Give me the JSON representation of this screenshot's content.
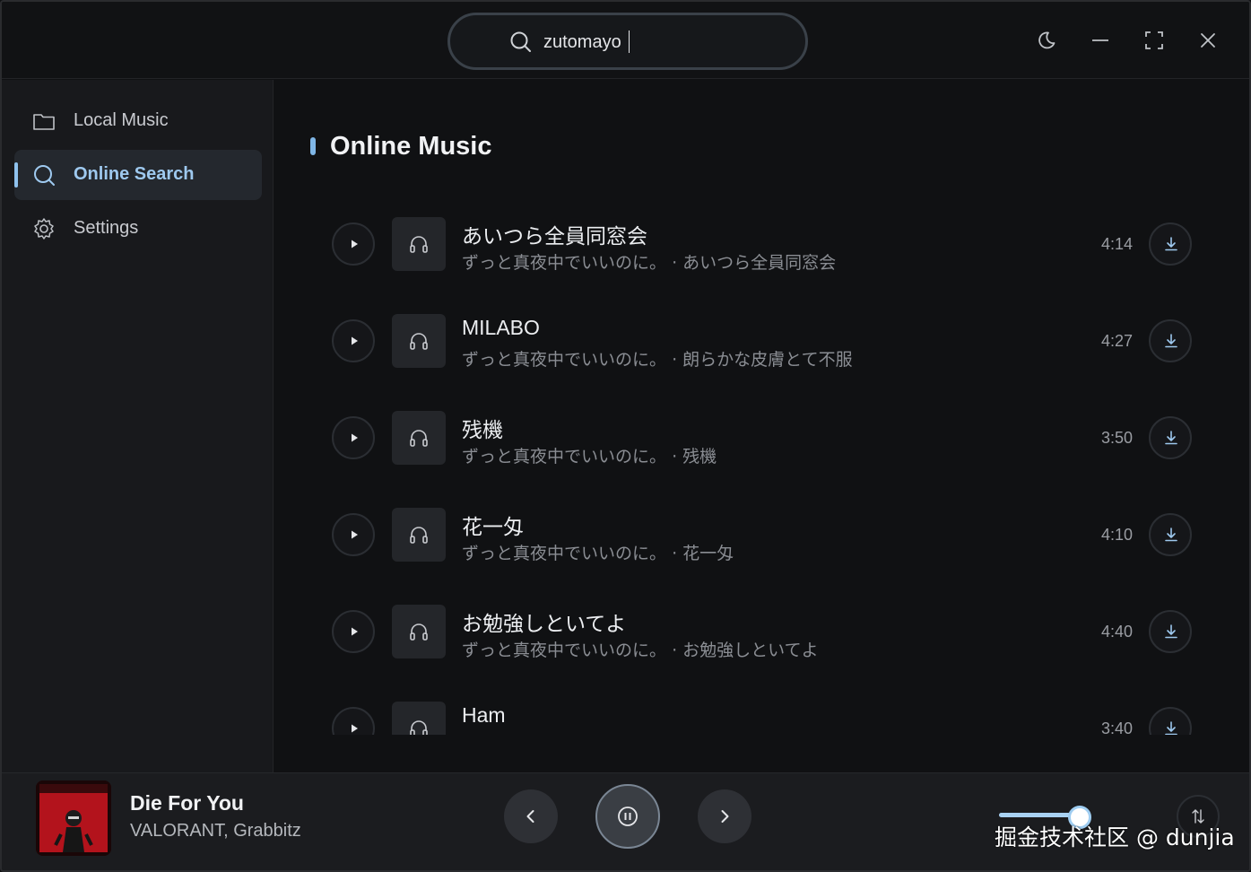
{
  "titlebar": {
    "search_value": "zutomayo"
  },
  "sidebar": {
    "items": [
      {
        "label": "Local Music",
        "icon": "folder-icon",
        "active": false
      },
      {
        "label": "Online Search",
        "icon": "search-icon",
        "active": true
      },
      {
        "label": "Settings",
        "icon": "gear-icon",
        "active": false
      }
    ]
  },
  "main": {
    "section_title": "Online Music",
    "songs": [
      {
        "title": "あいつら全員同窓会",
        "artist": "ずっと真夜中でいいのに。",
        "album": "· あいつら全員同窓会",
        "duration": "4:14"
      },
      {
        "title": "MILABO",
        "artist": "ずっと真夜中でいいのに。",
        "album": "· 朗らかな皮膚とて不服",
        "duration": "4:27"
      },
      {
        "title": "残機",
        "artist": "ずっと真夜中でいいのに。",
        "album": "· 残機",
        "duration": "3:50"
      },
      {
        "title": "花一匁",
        "artist": "ずっと真夜中でいいのに。",
        "album": "· 花一匁",
        "duration": "4:10"
      },
      {
        "title": "お勉強しといてよ",
        "artist": "ずっと真夜中でいいのに。",
        "album": "· お勉強しといてよ",
        "duration": "4:40"
      },
      {
        "title": "Ham",
        "artist": "",
        "album": "",
        "duration": "3:40"
      }
    ]
  },
  "player": {
    "title": "Die For You",
    "artist": "VALORANT, Grabbitz",
    "volume": 0.85,
    "state": "playing"
  },
  "watermark": "掘金技术社区 @ dunjia",
  "colors": {
    "accent": "#9ec9ef",
    "background": "#101113",
    "sidebar": "#18191c"
  }
}
